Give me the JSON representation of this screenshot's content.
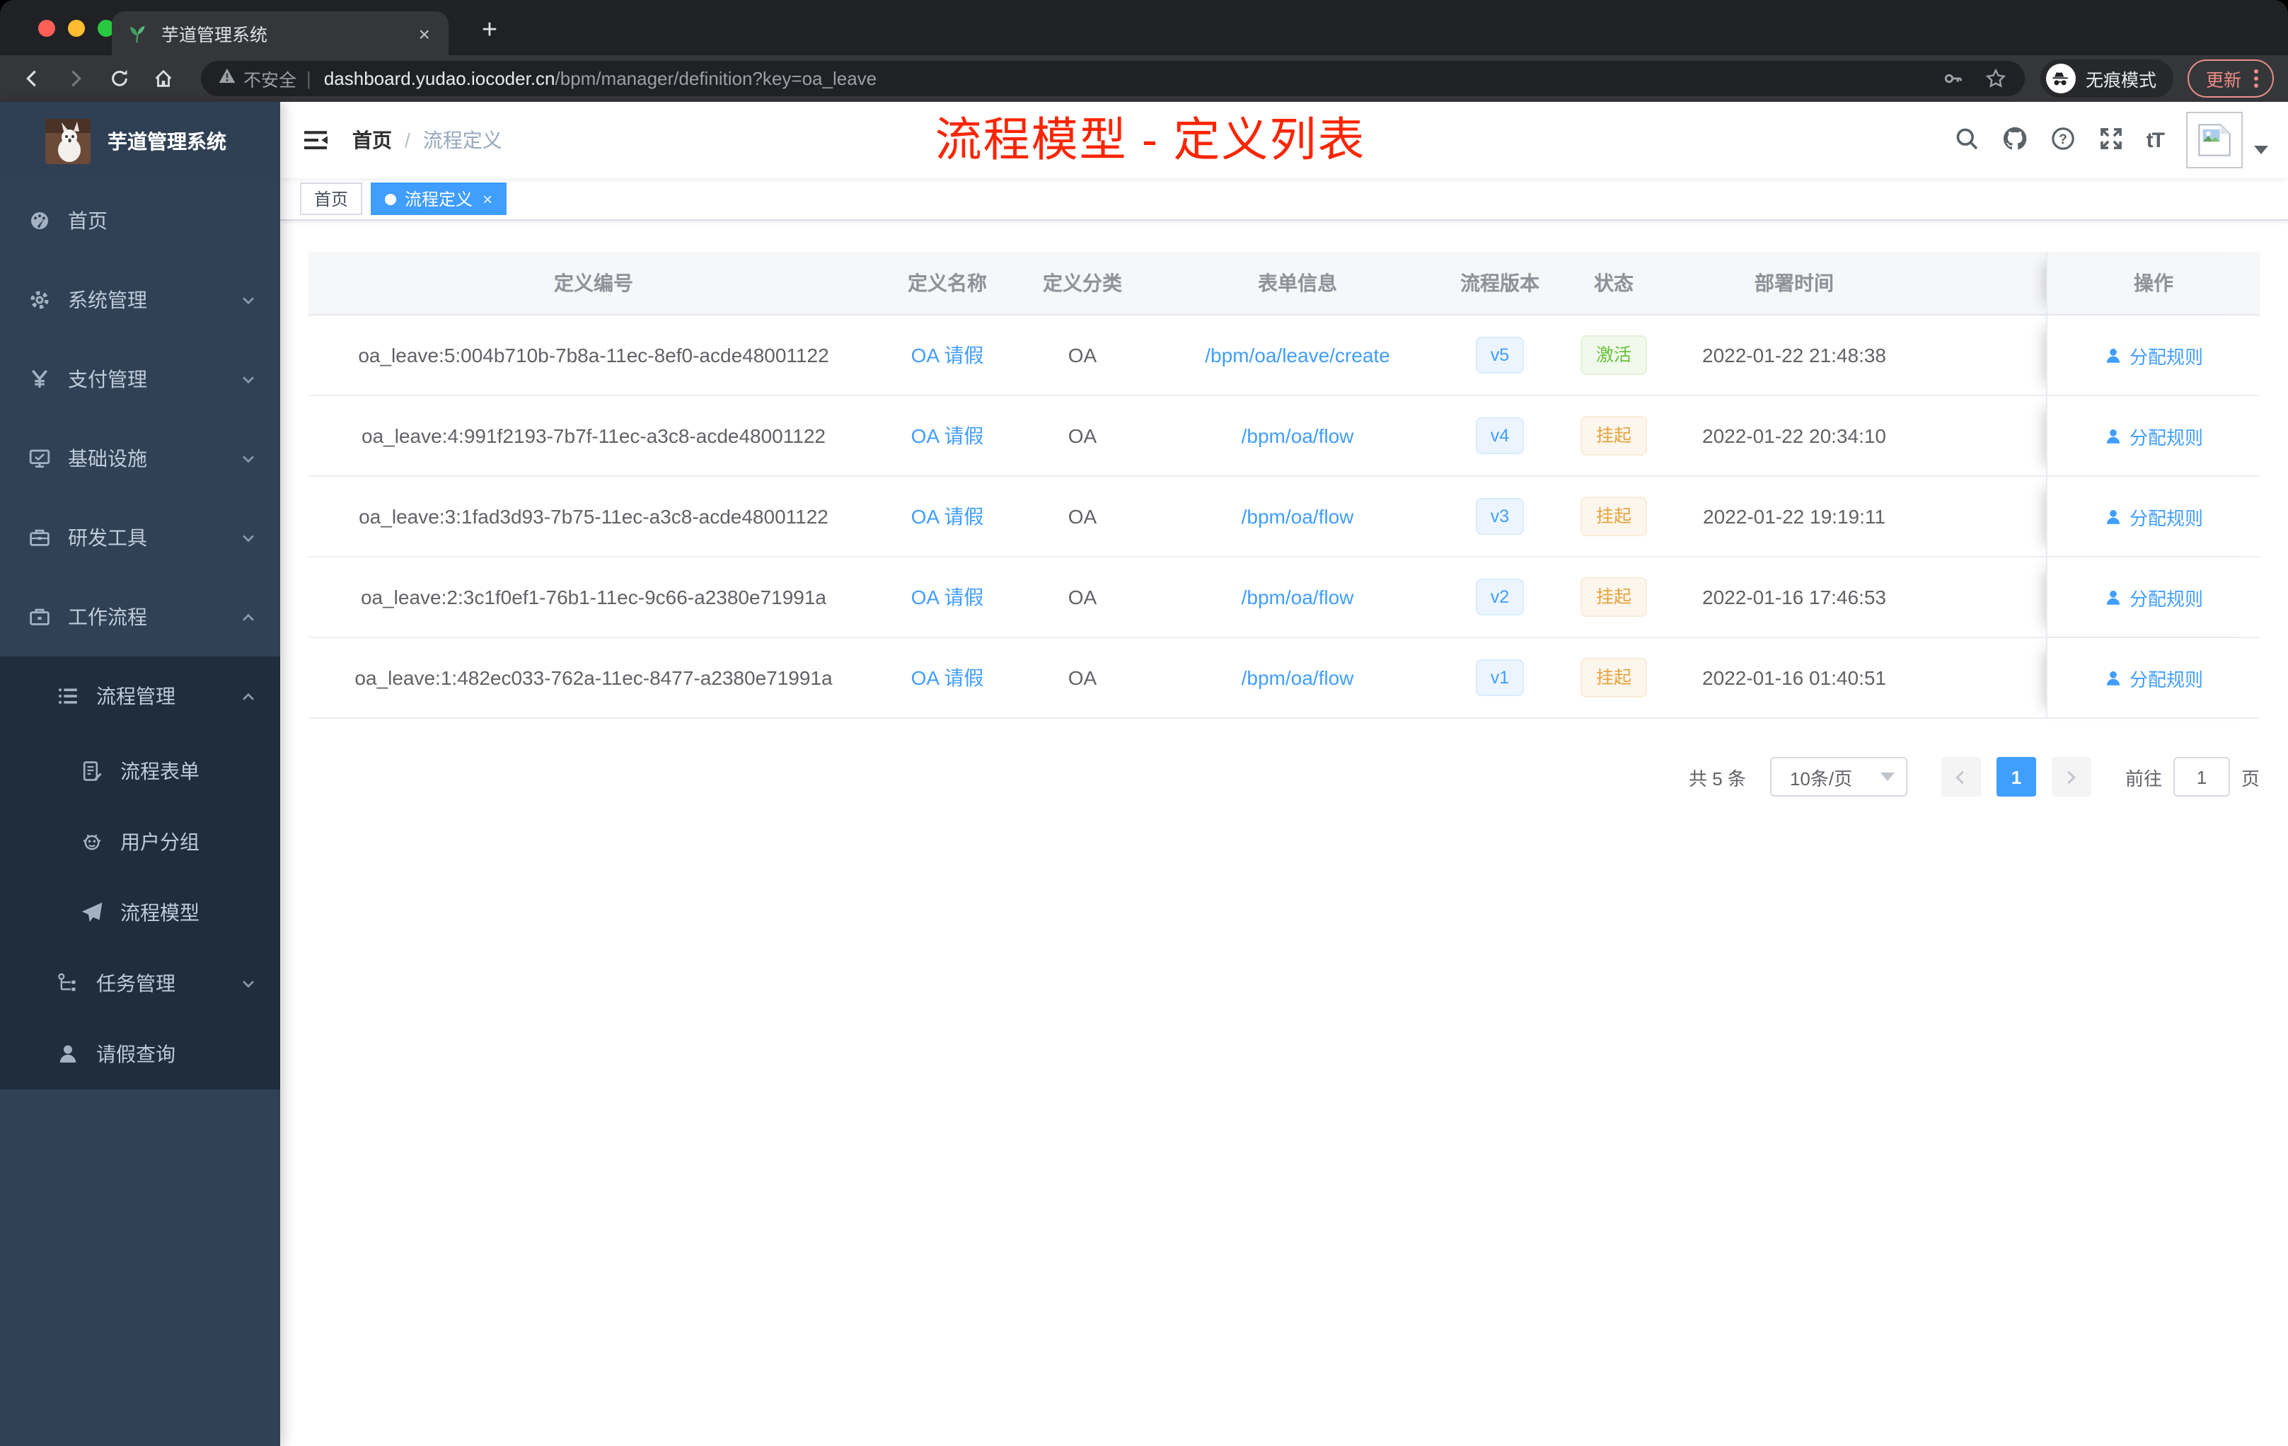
{
  "browser": {
    "tab": {
      "title": "芋道管理系统",
      "close_glyph": "×",
      "new_tab_glyph": "+"
    },
    "address": {
      "security": "不安全",
      "separator": "|",
      "host": "dashboard.yudao.iocoder.cn",
      "path": "/bpm/manager/definition?key=oa_leave"
    },
    "incognito_label": "无痕模式",
    "update_label": "更新"
  },
  "sidebar": {
    "logo_title": "芋道管理系统",
    "items": [
      {
        "label": "首页",
        "icon": "dashboard-icon",
        "level": 0,
        "in_submenu": false,
        "arrow": ""
      },
      {
        "label": "系统管理",
        "icon": "gear-icon",
        "level": 0,
        "in_submenu": false,
        "arrow": "down"
      },
      {
        "label": "支付管理",
        "icon": "yen-icon",
        "level": 0,
        "in_submenu": false,
        "arrow": "down"
      },
      {
        "label": "基础设施",
        "icon": "monitor-icon",
        "level": 0,
        "in_submenu": false,
        "arrow": "down"
      },
      {
        "label": "研发工具",
        "icon": "toolbox-icon",
        "level": 0,
        "in_submenu": false,
        "arrow": "down"
      },
      {
        "label": "工作流程",
        "icon": "briefcase-icon",
        "level": 0,
        "in_submenu": false,
        "arrow": "up"
      },
      {
        "label": "流程管理",
        "icon": "list-icon",
        "level": 1,
        "in_submenu": true,
        "arrow": "up"
      },
      {
        "label": "流程表单",
        "icon": "form-icon",
        "level": 2,
        "in_submenu": true,
        "arrow": ""
      },
      {
        "label": "用户分组",
        "icon": "users-icon",
        "level": 2,
        "in_submenu": true,
        "arrow": ""
      },
      {
        "label": "流程模型",
        "icon": "send-icon",
        "level": 2,
        "in_submenu": true,
        "arrow": ""
      },
      {
        "label": "任务管理",
        "icon": "tree-icon",
        "level": 1,
        "in_submenu": true,
        "arrow": "down",
        "short": true
      },
      {
        "label": "请假查询",
        "icon": "user-icon",
        "level": 1,
        "in_submenu": true,
        "arrow": "",
        "short": true
      }
    ]
  },
  "navbar": {
    "breadcrumb": [
      "首页",
      "流程定义"
    ],
    "breadcrumb_separator": "/",
    "annotation": "流程模型 - 定义列表",
    "font_icon_text": "tT"
  },
  "tags": [
    {
      "label": "首页",
      "active": false,
      "closable": false,
      "close_glyph": "×"
    },
    {
      "label": "流程定义",
      "active": true,
      "closable": true,
      "close_glyph": "×"
    }
  ],
  "table": {
    "columns": [
      "定义编号",
      "定义名称",
      "定义分类",
      "表单信息",
      "流程版本",
      "状态",
      "部署时间",
      "操作"
    ],
    "rows": [
      {
        "id": "oa_leave:5:004b710b-7b8a-11ec-8ef0-acde48001122",
        "name": "OA 请假",
        "category": "OA",
        "form": "/bpm/oa/leave/create",
        "version": "v5",
        "status": "激活",
        "status_type": "success",
        "deploy_time": "2022-01-22 21:48:38",
        "action": "分配规则"
      },
      {
        "id": "oa_leave:4:991f2193-7b7f-11ec-a3c8-acde48001122",
        "name": "OA 请假",
        "category": "OA",
        "form": "/bpm/oa/flow",
        "version": "v4",
        "status": "挂起",
        "status_type": "warning",
        "deploy_time": "2022-01-22 20:34:10",
        "action": "分配规则"
      },
      {
        "id": "oa_leave:3:1fad3d93-7b75-11ec-a3c8-acde48001122",
        "name": "OA 请假",
        "category": "OA",
        "form": "/bpm/oa/flow",
        "version": "v3",
        "status": "挂起",
        "status_type": "warning",
        "deploy_time": "2022-01-22 19:19:11",
        "action": "分配规则"
      },
      {
        "id": "oa_leave:2:3c1f0ef1-76b1-11ec-9c66-a2380e71991a",
        "name": "OA 请假",
        "category": "OA",
        "form": "/bpm/oa/flow",
        "version": "v2",
        "status": "挂起",
        "status_type": "warning",
        "deploy_time": "2022-01-16 17:46:53",
        "action": "分配规则"
      },
      {
        "id": "oa_leave:1:482ec033-762a-11ec-8477-a2380e71991a",
        "name": "OA 请假",
        "category": "OA",
        "form": "/bpm/oa/flow",
        "version": "v1",
        "status": "挂起",
        "status_type": "warning",
        "deploy_time": "2022-01-16 01:40:51",
        "action": "分配规则"
      }
    ]
  },
  "pagination": {
    "total": "共 5 条",
    "page_size": "10条/页",
    "active_page": "1",
    "goto_label": "前往",
    "goto_value": "1",
    "goto_suffix": "页"
  },
  "colors": {
    "accent": "#409eff",
    "success": "#67c23a",
    "warning": "#e6a23c",
    "annotation_red": "#fb2500",
    "sidebar_bg": "#304156",
    "submenu_bg": "#1f2d3d"
  }
}
